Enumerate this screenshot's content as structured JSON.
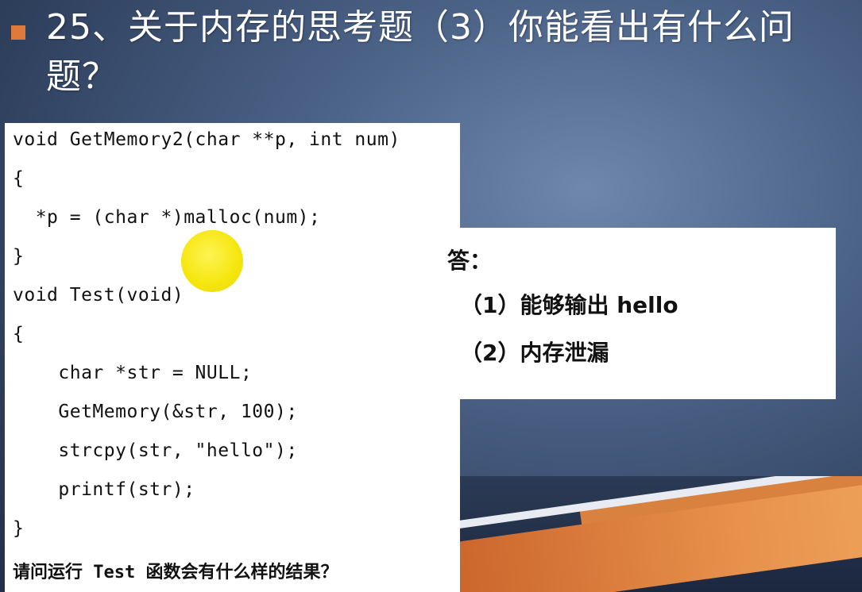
{
  "slide": {
    "title": "25、关于内存的思考题（3）你能看出有什么问题？"
  },
  "code": {
    "lines": [
      "void GetMemory2(char **p, int num)",
      "{",
      "  *p = (char *)malloc(num);",
      "}",
      "void Test(void)",
      "{",
      "    char *str = NULL;",
      "    GetMemory(&str, 100);",
      "    strcpy(str, \"hello\");",
      "    printf(str);",
      "}"
    ],
    "question": "请问运行 Test 函数会有什么样的结果？"
  },
  "answer": {
    "title": "答：",
    "items": [
      "（1）能够输出 hello",
      "（2）内存泄漏"
    ]
  },
  "colors": {
    "bullet": "#e07a3c",
    "pointer": "#f5e400",
    "background": "#4b6287"
  }
}
